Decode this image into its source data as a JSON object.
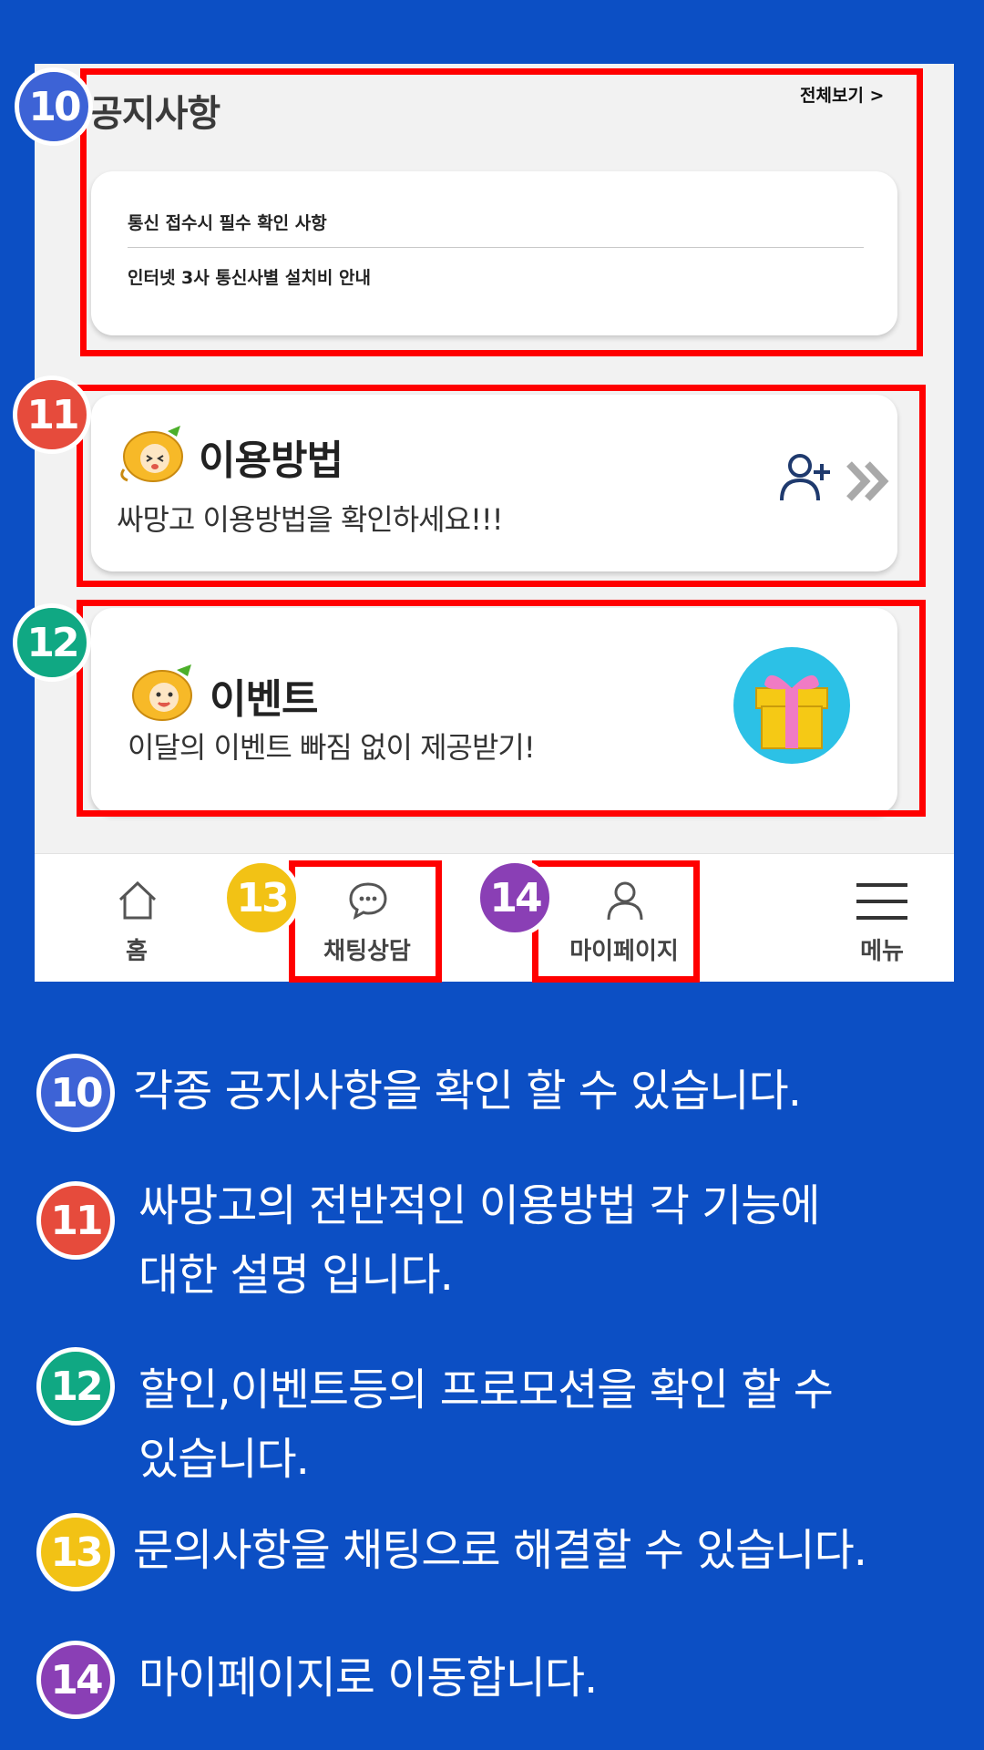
{
  "colors": {
    "background": "#0c4fc4",
    "highlight": "#ff0000",
    "badge_10": "#3d63d6",
    "badge_11": "#e64b3c",
    "badge_12": "#10a883",
    "badge_13": "#f2c215",
    "badge_14": "#8a3fb5"
  },
  "notice": {
    "title": "공지사항",
    "view_all": "전체보기 >",
    "items": [
      "통신 접수시 필수 확인 사항",
      "인터넷 3사 통신사별 설치비 안내"
    ]
  },
  "usage": {
    "title": "이용방법",
    "desc": "싸망고 이용방법을 확인하세요!!!",
    "icons": [
      "mango-mascot-icon",
      "add-user-icon",
      "double-chevron-right-icon"
    ]
  },
  "event": {
    "title": "이벤트",
    "desc": "이달의 이벤트 빠짐 없이 제공받기!",
    "icons": [
      "mango-mascot-icon",
      "gift-icon"
    ]
  },
  "bottom_nav": {
    "home": "홈",
    "chat": "채팅상담",
    "mypage": "마이페이지",
    "menu": "메뉴"
  },
  "badges": {
    "b10": "10",
    "b11": "11",
    "b12": "12",
    "b13": "13",
    "b14": "14"
  },
  "descriptions": {
    "d10": "각종 공지사항을 확인 할 수 있습니다.",
    "d11_line1": "싸망고의 전반적인 이용방법 각 기능에",
    "d11_line2": "대한 설명 입니다.",
    "d12_line1": "할인,이벤트등의 프로모션을 확인 할 수",
    "d12_line2": "있습니다.",
    "d13": "문의사항을 채팅으로 해결할 수 있습니다.",
    "d14": "마이페이지로 이동합니다."
  }
}
